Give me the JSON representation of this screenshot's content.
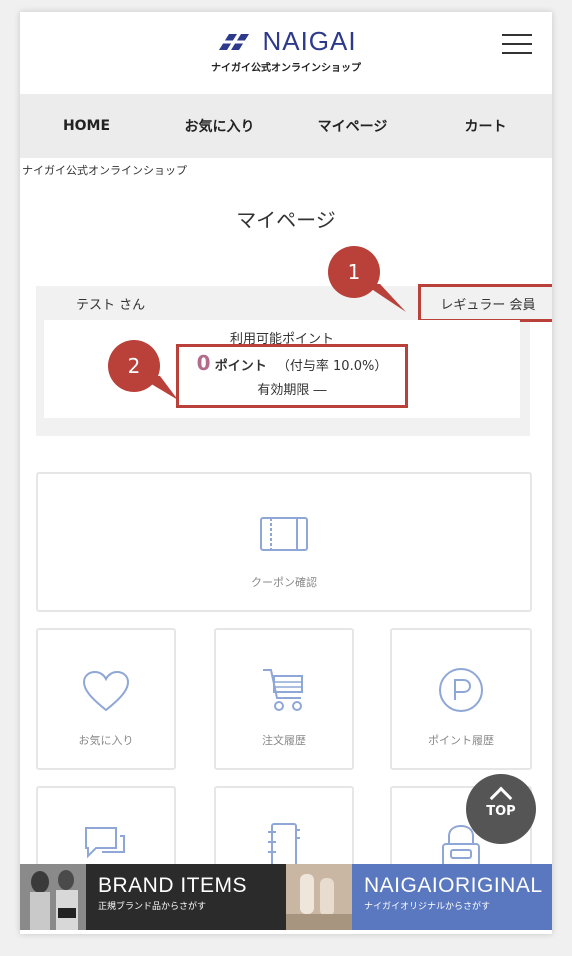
{
  "header": {
    "logo_text": "NAIGAI",
    "logo_sub": "ナイガイ公式オンラインショップ"
  },
  "nav": [
    {
      "label": "HOME"
    },
    {
      "label": "お気に入り"
    },
    {
      "label": "マイページ"
    },
    {
      "label": "カート"
    }
  ],
  "breadcrumb": "ナイガイ公式オンラインショップ",
  "page_title": "マイページ",
  "member": {
    "name": "テスト さん",
    "rank": "レギュラー 会員"
  },
  "points": {
    "label": "利用可能ポイント",
    "value": "0",
    "unit": "ポイント",
    "rate": "（付与率 10.0%）",
    "expiry": "有効期限 ―"
  },
  "callouts": [
    "1",
    "2"
  ],
  "tiles": {
    "coupon": "クーポン確認",
    "favorites": "お気に入り",
    "orders": "注文履歴",
    "points_history": "ポイント履歴"
  },
  "top_button": "TOP",
  "banners": {
    "brand_title": "BRAND ITEMS",
    "brand_sub": "正規ブランド品からさがす",
    "original_title": "NAIGAIORIGINAL",
    "original_sub": "ナイガイオリジナルからさがす"
  },
  "colors": {
    "accent_red": "#b9413a",
    "brand_blue": "#2d3a8c",
    "icon_blue": "#8fa7d6",
    "banner_dark": "#2b2b2b",
    "banner_blue": "#5a78c0"
  }
}
